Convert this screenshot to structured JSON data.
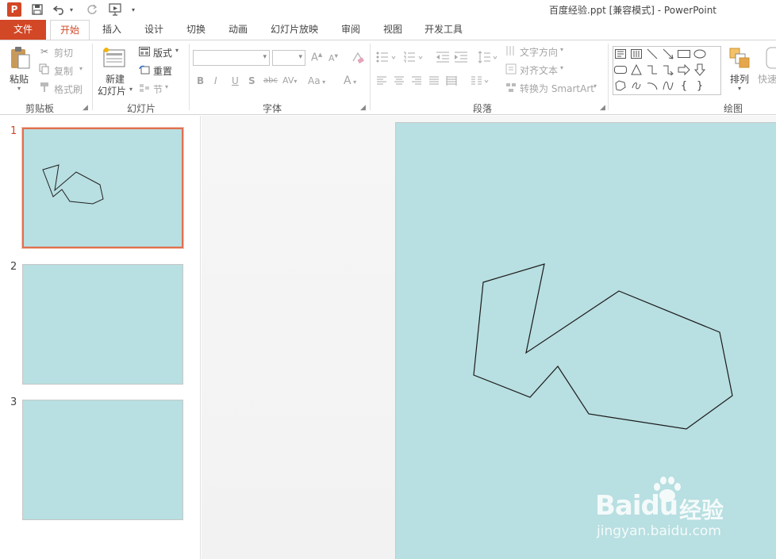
{
  "window": {
    "app_badge": "P",
    "title": "百度经验.ppt [兼容模式] - PowerPoint"
  },
  "tabs": [
    {
      "label": "文件"
    },
    {
      "label": "开始"
    },
    {
      "label": "插入"
    },
    {
      "label": "设计"
    },
    {
      "label": "切换"
    },
    {
      "label": "动画"
    },
    {
      "label": "幻灯片放映"
    },
    {
      "label": "审阅"
    },
    {
      "label": "视图"
    },
    {
      "label": "开发工具"
    }
  ],
  "ribbon": {
    "clipboard": {
      "paste": "粘贴",
      "cut": "剪切",
      "copy": "复制",
      "format_painter": "格式刷",
      "group_label": "剪贴板"
    },
    "slides": {
      "new_slide_line1": "新建",
      "new_slide_line2": "幻灯片",
      "layout": "版式",
      "reset": "重置",
      "section": "节",
      "group_label": "幻灯片"
    },
    "font": {
      "font_name": "",
      "font_size": "",
      "bold": "B",
      "italic": "I",
      "underline": "U",
      "shadow": "S",
      "strike": "abc",
      "spacing": "AV",
      "case": "Aa",
      "color": "A",
      "grow": "A",
      "shrink": "A",
      "group_label": "字体"
    },
    "paragraph": {
      "text_direction": "文字方向",
      "align_text": "对齐文本",
      "convert_smartart": "转换为 SmartArt",
      "group_label": "段落"
    },
    "drawing": {
      "arrange": "排列",
      "quick_styles": "快速",
      "group_label": "绘图"
    }
  },
  "slides": [
    {
      "number": "1",
      "selected": true
    },
    {
      "number": "2",
      "selected": false
    },
    {
      "number": "3",
      "selected": false
    }
  ],
  "colors": {
    "accent": "#d24726",
    "slide_bg": "#b8dfe1",
    "selection": "#e07050"
  },
  "watermark": {
    "logo": "Bai",
    "logo_suffix": "du",
    "cn_text": "经验",
    "url": "jingyan.baidu.com"
  }
}
